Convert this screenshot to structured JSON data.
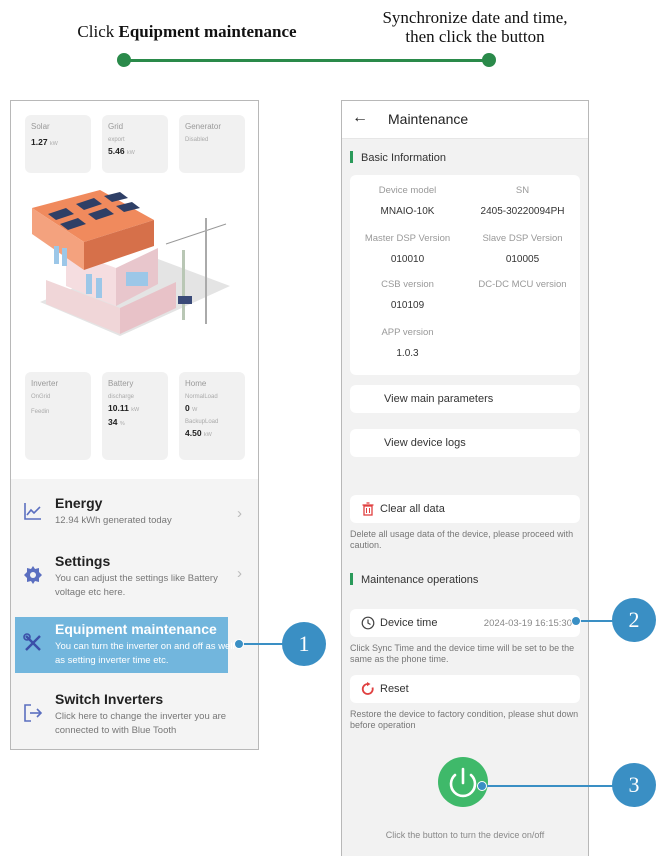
{
  "steps": {
    "step1_prefix": "Click ",
    "step1_bold": "Equipment maintenance",
    "step2_line1": "Synchronize date and time,",
    "step2_line2": "then click the button"
  },
  "left_phone": {
    "tiles": {
      "solar": {
        "title": "Solar",
        "value": "1.27",
        "unit": "kW"
      },
      "grid": {
        "title": "Grid",
        "status": "export",
        "value": "5.46",
        "unit": "kW"
      },
      "generator": {
        "title": "Generator",
        "status": "Disabled"
      },
      "inverter": {
        "title": "Inverter",
        "line1": "OnGrid",
        "line2": "Feedin"
      },
      "battery": {
        "title": "Battery",
        "status": "discharge",
        "value": "10.11",
        "unit": "kW",
        "soc": "34",
        "soc_unit": "%"
      },
      "home": {
        "title": "Home",
        "normal_label": "NormalLoad",
        "normal_value": "0",
        "normal_unit": "W",
        "backup_label": "BackupLoad",
        "backup_value": "4.50",
        "backup_unit": "kW"
      }
    },
    "menu": {
      "energy": {
        "title": "Energy",
        "subtitle": "12.94 kWh generated today",
        "icon": "chart-icon"
      },
      "settings": {
        "title": "Settings",
        "subtitle": "You can adjust the settings like Battery voltage etc here.",
        "icon": "gear-icon"
      },
      "maintenance": {
        "title": "Equipment maintenance",
        "subtitle": "You can turn the inverter on and off as well as setting inverter time etc.",
        "icon": "tools-icon"
      },
      "switch": {
        "title": "Switch Inverters",
        "subtitle": "Click here to change the inverter you are connected to with Blue Tooth",
        "icon": "exit-icon"
      }
    }
  },
  "right_phone": {
    "header": {
      "back": "←",
      "title": "Maintenance"
    },
    "basic_info": {
      "heading": "Basic Information",
      "fields": [
        {
          "label": "Device model",
          "value": "MNAIO-10K"
        },
        {
          "label": "SN",
          "value": "2405-30220094PH"
        },
        {
          "label": "Master DSP Version",
          "value": "010010"
        },
        {
          "label": "Slave DSP Version",
          "value": "010005"
        },
        {
          "label": "CSB version",
          "value": "010109"
        },
        {
          "label": "DC-DC MCU version",
          "value": ""
        },
        {
          "label": "APP version",
          "value": "1.0.3"
        }
      ]
    },
    "view_params": "View main parameters",
    "view_logs": "View device logs",
    "clear": {
      "label": "Clear all data",
      "note": "Delete all usage data of the device, please proceed with caution."
    },
    "maintenance_ops": {
      "heading": "Maintenance operations"
    },
    "device_time": {
      "label": "Device time",
      "value": "2024-03-19 16:15:30",
      "note": "Click Sync Time and the device time will be set to be the same as the phone time."
    },
    "reset": {
      "label": "Reset",
      "note": "Restore the device to factory condition, please shut down before operation"
    },
    "power_caption": "Click the button to turn the device on/off"
  },
  "callouts": [
    "1",
    "2",
    "3"
  ],
  "colors": {
    "accent_green": "#2a8a4a",
    "callout_blue": "#3a8fc4",
    "highlight": "#5aaad8",
    "power_green": "#3fb96a"
  }
}
